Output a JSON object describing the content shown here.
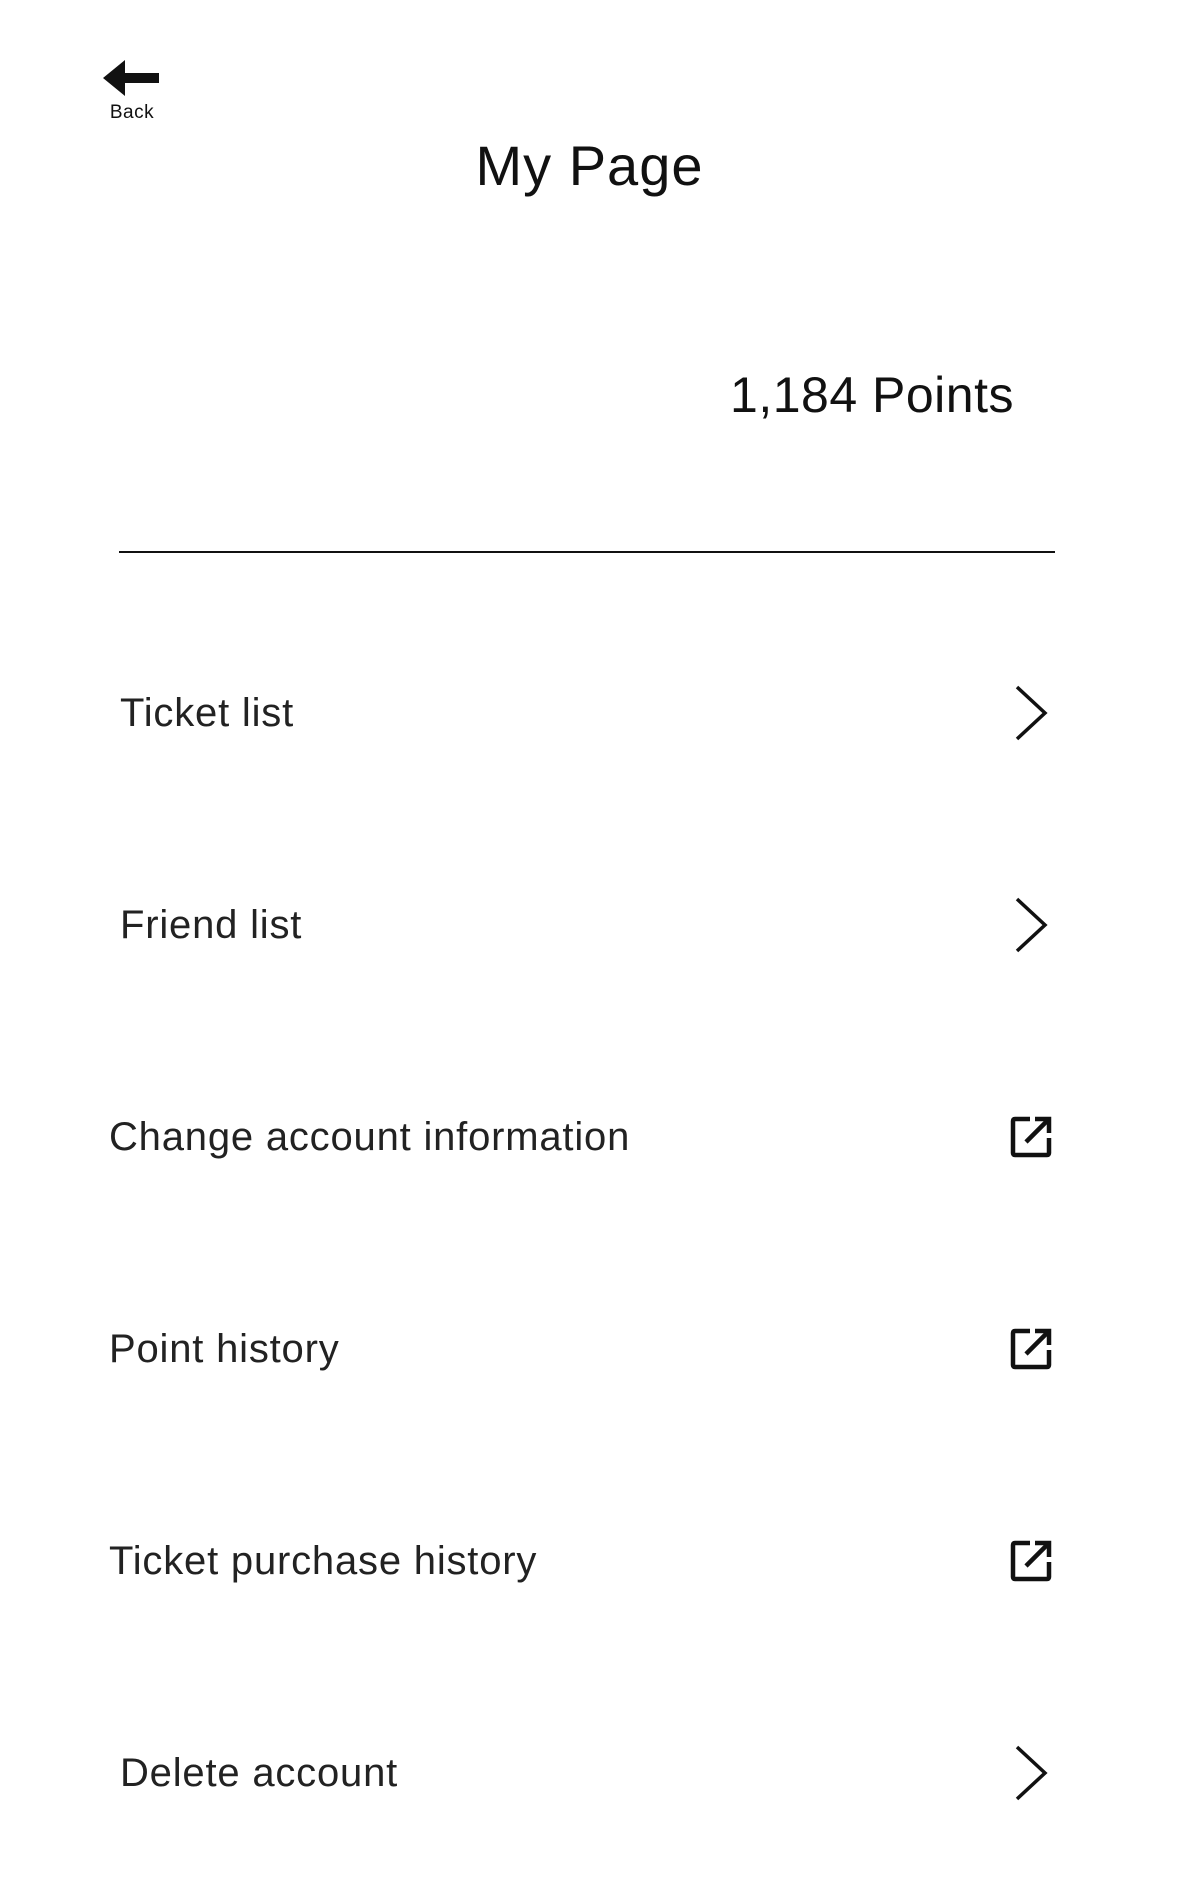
{
  "header": {
    "back_label": "Back",
    "title": "My Page"
  },
  "points": {
    "text": "1,184 Points"
  },
  "menu": {
    "items": [
      {
        "label": "Ticket list",
        "icon": "chevron-right-icon"
      },
      {
        "label": "Friend list",
        "icon": "chevron-right-icon"
      },
      {
        "label": "Change account information",
        "icon": "external-link-icon"
      },
      {
        "label": "Point history",
        "icon": "external-link-icon"
      },
      {
        "label": "Ticket purchase history",
        "icon": "external-link-icon"
      },
      {
        "label": "Delete account",
        "icon": "chevron-right-icon"
      }
    ]
  },
  "colors": {
    "background": "#ffffff",
    "text": "#111111"
  }
}
